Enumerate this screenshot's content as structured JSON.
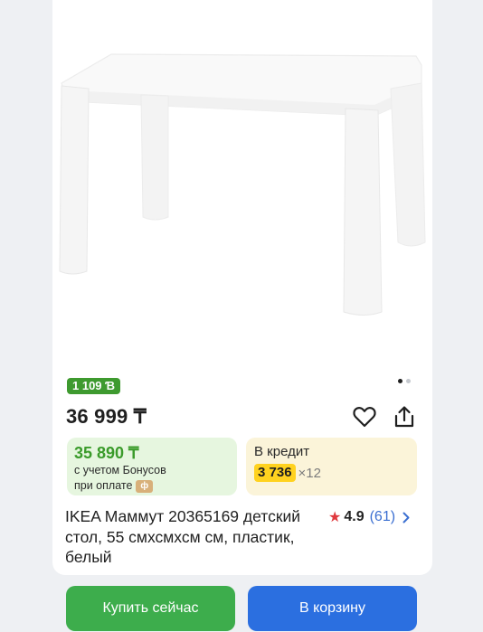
{
  "product": {
    "bonus_badge": "1 109 Ɓ",
    "price": "36 999 ₸",
    "title": "IKEA Маммут 20365169 детский стол, 55 смхсмхсм см, пластик, белый",
    "rating": "4.9",
    "reviews": "(61)",
    "image_icon": "white-kids-table-image",
    "gallery": {
      "total": 2,
      "active": 1
    }
  },
  "bonus": {
    "price": "35 890 ₸",
    "note_line1": "с учетом Бонусов",
    "note_line2": "при оплате",
    "coin": "ф"
  },
  "credit": {
    "title": "В кредит",
    "amount": "3 736",
    "multiplier": "×12"
  },
  "actions": {
    "buy_now": "Купить сейчас",
    "add_to_cart": "В корзину",
    "favorite_icon": "heart-icon",
    "share_icon": "share-icon"
  },
  "colors": {
    "bonus_green": "#3a9b2a",
    "buy_green": "#3dad4c",
    "cart_blue": "#2b6fe0",
    "credit_yellow": "#ffd21f",
    "star_red": "#e0393e",
    "link_blue": "#3b6fd1"
  }
}
